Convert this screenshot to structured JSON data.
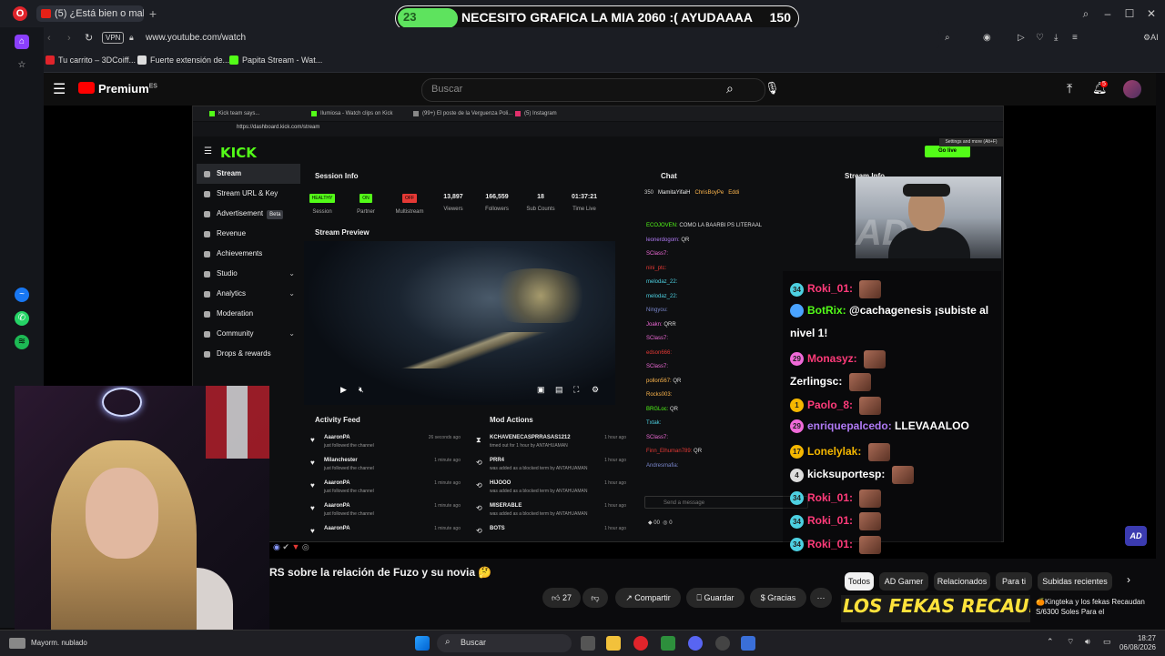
{
  "browser": {
    "active_tab": "(5) ¿Está bien o mal? ...",
    "url": "www.youtube.com/watch",
    "vpn_label": "VPN",
    "bookmarks": [
      "Tu carrito – 3DCoiff...",
      "Fuerte extensión de...",
      "Papita Stream - Wat..."
    ]
  },
  "title_banner": {
    "left_value": "23",
    "text": "NECESITO GRAFICA LA MIA 2060 :( AYUDAAAA",
    "right_value": "150",
    "progress_fraction": 0.15
  },
  "youtube": {
    "logo": "Premium",
    "logo_sup": "ES",
    "search_placeholder": "Buscar",
    "notif_count": "5",
    "video_title": "RS sobre la relación de Fuzo y su novia 🤔",
    "likes": "27",
    "share": "Compartir",
    "save": "Guardar",
    "thanks": "Gracias",
    "chips": [
      "Todos",
      "AD Gamer",
      "Relacionados",
      "Para ti",
      "Subidas recientes"
    ],
    "rec_thumb_text": "LOS FEKAS RECAUDAN",
    "rec_title": "🍊Kingteka y los fekas Recaudan S/6300 Soles Para el"
  },
  "kick": {
    "tabs": [
      "Kick team says...",
      "Ilumiosa - Watch clips on Kick",
      "(99+) El poste de la Verguenza Poli...",
      "(5) Instagram"
    ],
    "url": "https://dashboard.kick.com/stream",
    "logo": "KICK",
    "nav": [
      {
        "label": "Stream",
        "active": true,
        "chev": false
      },
      {
        "label": "Stream URL & Key",
        "active": false,
        "chev": false
      },
      {
        "label": "Advertisement",
        "active": false,
        "chev": false,
        "badge": "Beta"
      },
      {
        "label": "Revenue",
        "active": false,
        "chev": false
      },
      {
        "label": "Achievements",
        "active": false,
        "chev": false
      },
      {
        "label": "Studio",
        "active": false,
        "chev": true
      },
      {
        "label": "Analytics",
        "active": false,
        "chev": true
      },
      {
        "label": "Moderation",
        "active": false,
        "chev": false
      },
      {
        "label": "Community",
        "active": false,
        "chev": true
      },
      {
        "label": "Drops & rewards",
        "active": false,
        "chev": false
      }
    ],
    "session_info_title": "Session Info",
    "session_stats": [
      {
        "pill": "HEALTHY",
        "pill_color": "#53fc18",
        "label": "Session"
      },
      {
        "pill": "ON",
        "pill_color": "#53fc18",
        "label": "Partner"
      },
      {
        "pill": "OFF",
        "pill_color": "#e53935",
        "label": "Multistream"
      },
      {
        "value": "13,897",
        "label": "Viewers"
      },
      {
        "value": "166,559",
        "label": "Followers"
      },
      {
        "value": "18",
        "label": "Sub Counts"
      },
      {
        "value": "01:37:21",
        "label": "Time Live"
      }
    ],
    "preview_title": "Stream Preview",
    "activity_title": "Activity Feed",
    "activity": [
      {
        "name": "AaaronPA",
        "sub": "just followed the channel",
        "time": "26 seconds ago"
      },
      {
        "name": "Milanchester",
        "sub": "just followed the channel",
        "time": "1 minute ago"
      },
      {
        "name": "AaaronPA",
        "sub": "just followed the channel",
        "time": "1 minute ago"
      },
      {
        "name": "AaaronPA",
        "sub": "just followed the channel",
        "time": "1 minute ago"
      },
      {
        "name": "AaaronPA",
        "sub": "",
        "time": "1 minute ago"
      }
    ],
    "mod_title": "Mod Actions",
    "mod": [
      {
        "name": "KCHAVENECASPRRASAS1212",
        "sub": "timed out for 1 hour by ANTAHUAMAN",
        "time": "1 hour ago"
      },
      {
        "name": "PRR4",
        "sub": "was added as a blocked term by ANTAHUAMAN",
        "time": "1 hour ago"
      },
      {
        "name": "HIJOOO",
        "sub": "was added as a blocked term by ANTAHUAMAN",
        "time": "1 hour ago"
      },
      {
        "name": "MISERABLE",
        "sub": "was added as a blocked term by ANTAHUAMAN",
        "time": "1 hour ago"
      },
      {
        "name": "BOTS",
        "sub": "",
        "time": "1 hour ago"
      }
    ],
    "chat_title": "Chat",
    "chat_top": [
      "350",
      "MamitaYifaiH",
      "ChrisBoyPe",
      "Eddi"
    ],
    "chat_lines": [
      {
        "user": "ECOJOVEN:",
        "msg": "COMO LA BAARBI PS LITERAAL",
        "color": "#53fc18"
      },
      {
        "user": "leonerdogom:",
        "msg": "QR",
        "color": "#b07af5"
      },
      {
        "user": "SClass7:",
        "msg": "",
        "color": "#f06ad8"
      },
      {
        "user": "nini_ptc:",
        "msg": "",
        "color": "#e53935"
      },
      {
        "user": "melodaz_22:",
        "msg": "",
        "color": "#4dd0e1"
      },
      {
        "user": "melodaz_22:",
        "msg": "",
        "color": "#4dd0e1"
      },
      {
        "user": "Ningyou:",
        "msg": "",
        "color": "#7986cb"
      },
      {
        "user": "Joakn:",
        "msg": "QRR",
        "color": "#f06ad8"
      },
      {
        "user": "SClass7:",
        "msg": "",
        "color": "#f06ad8"
      },
      {
        "user": "edson666:",
        "msg": "",
        "color": "#e53935"
      },
      {
        "user": "SClass7:",
        "msg": "",
        "color": "#f06ad8"
      },
      {
        "user": "pollon567:",
        "msg": "QR",
        "color": "#ffb74d"
      },
      {
        "user": "Rocks003:",
        "msg": "",
        "color": "#ffb74d"
      },
      {
        "user": "BRGLoc:",
        "msg": "QR",
        "color": "#53fc18"
      },
      {
        "user": "Txtak:",
        "msg": "",
        "color": "#4dd0e1"
      },
      {
        "user": "SClass7:",
        "msg": "",
        "color": "#f06ad8"
      },
      {
        "user": "Finn_Elhuman789:",
        "msg": "QR",
        "color": "#e53935"
      },
      {
        "user": "Andresmafia:",
        "msg": "",
        "color": "#7986cb"
      }
    ],
    "chat_placeholder": "Send a message",
    "chat_footer_a": "00",
    "chat_footer_b": "0",
    "go_live": "Go live",
    "tooltip": "Settings and more (Alt+F)",
    "stream_info_title": "Stream Info"
  },
  "overlay_chat": [
    {
      "badge": "34",
      "badge_color": "#4dd0e1",
      "user": "Roki_01:",
      "user_color": "#ff3b7a",
      "msg": "",
      "emote": true
    },
    {
      "badge": "",
      "badge_color": "#4aa3ff",
      "user": "BotRix:",
      "user_color": "#53fc18",
      "msg": "@cachagenesis ¡subiste al",
      "emote": false
    },
    {
      "badge": "",
      "badge_color": "",
      "user": "nivel 1!",
      "user_color": "#ffffff",
      "msg": "",
      "emote": false
    },
    {
      "badge": "29",
      "badge_color": "#f06ad8",
      "user": "Monasyz:",
      "user_color": "#ff3b7a",
      "msg": "",
      "emote": true
    },
    {
      "badge": "",
      "badge_color": "",
      "user": "Zerlingsc:",
      "user_color": "#ffffff",
      "msg": "",
      "emote": true
    },
    {
      "badge": "1",
      "badge_color": "#f5b700",
      "user": "Paolo_8:",
      "user_color": "#ff3b7a",
      "msg": "",
      "emote": true
    },
    {
      "badge": "29",
      "badge_color": "#f06ad8",
      "user": "enriquepalcedo:",
      "user_color": "#b07af5",
      "msg": "LLEVAAALOO",
      "emote": false
    },
    {
      "badge": "17",
      "badge_color": "#f5b700",
      "user": "Lonelylak:",
      "user_color": "#f5b700",
      "msg": "",
      "emote": true
    },
    {
      "badge": "4",
      "badge_color": "#dddddd",
      "user": "kicksuportesp:",
      "user_color": "#ffffff",
      "msg": "",
      "emote": true
    },
    {
      "badge": "34",
      "badge_color": "#4dd0e1",
      "user": "Roki_01:",
      "user_color": "#ff3b7a",
      "msg": "",
      "emote": true
    },
    {
      "badge": "34",
      "badge_color": "#4dd0e1",
      "user": "Roki_01:",
      "user_color": "#ff3b7a",
      "msg": "",
      "emote": true
    },
    {
      "badge": "34",
      "badge_color": "#4dd0e1",
      "user": "Roki_01:",
      "user_color": "#ff3b7a",
      "msg": "",
      "emote": true
    }
  ],
  "taskbar": {
    "weather": "Mayorm. nublado",
    "search": "Buscar",
    "time": "18:27",
    "date": "06/08/2026"
  }
}
